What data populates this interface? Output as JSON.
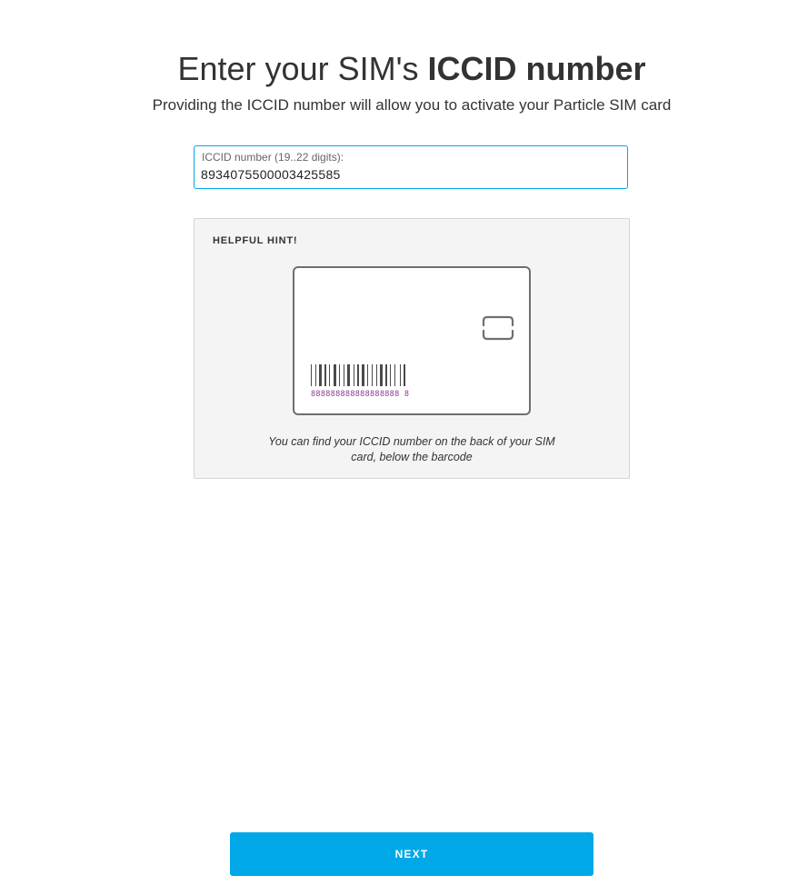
{
  "header": {
    "title_prefix": "Enter your SIM's ",
    "title_bold": "ICCID number",
    "subtitle": "Providing the ICCID number will allow you to activate your Particle SIM card"
  },
  "iccid_field": {
    "label": "ICCID number (19..22 digits):",
    "value": "8934075500003425585"
  },
  "hint": {
    "title": "HELPFUL HINT!",
    "card": {
      "chip_icon": "sim-chip-icon",
      "barcode_icon": "barcode-icon",
      "barcode_number": "888888888888888888 8"
    },
    "caption": "You can find your ICCID number on the back of your SIM card, below the barcode"
  },
  "footer": {
    "next_label": "NEXT"
  },
  "colors": {
    "accent": "#00a8e8",
    "barcode_number": "#8b3a8f"
  }
}
